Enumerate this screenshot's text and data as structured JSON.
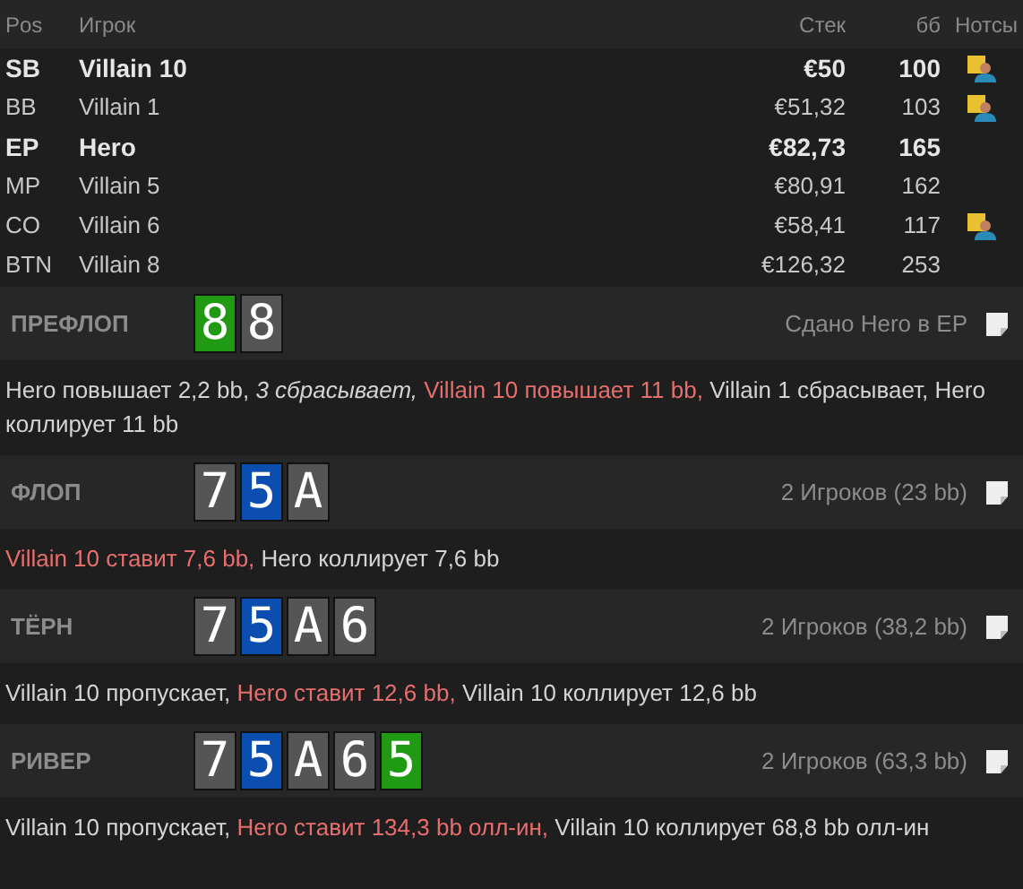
{
  "table": {
    "columns": [
      "Pos",
      "Игрок",
      "Стек",
      "бб",
      "Нотсы"
    ],
    "rows": [
      {
        "pos": "SB",
        "player": "Villain 10",
        "stack": "€50",
        "bb": "100",
        "highlighted": true,
        "has_note": true
      },
      {
        "pos": "BB",
        "player": "Villain 1",
        "stack": "€51,32",
        "bb": "103",
        "highlighted": false,
        "has_note": true
      },
      {
        "pos": "EP",
        "player": "Hero",
        "stack": "€82,73",
        "bb": "165",
        "highlighted": true,
        "has_note": false
      },
      {
        "pos": "MP",
        "player": "Villain 5",
        "stack": "€80,91",
        "bb": "162",
        "highlighted": false,
        "has_note": false
      },
      {
        "pos": "CO",
        "player": "Villain 6",
        "stack": "€58,41",
        "bb": "117",
        "highlighted": false,
        "has_note": true
      },
      {
        "pos": "BTN",
        "player": "Villain 8",
        "stack": "€126,32",
        "bb": "253",
        "highlighted": false,
        "has_note": false
      }
    ]
  },
  "streets": [
    {
      "name": "ПРЕФЛОП",
      "cards": [
        {
          "rank": "8",
          "color": "#1f9a12"
        },
        {
          "rank": "8",
          "color": "#555555"
        }
      ],
      "summary": "Сдано Hero в EP",
      "actions": [
        {
          "kind": "normal",
          "text": "Hero повышает 2,2 bb, "
        },
        {
          "kind": "italic",
          "text": "3 сбрасывает, "
        },
        {
          "kind": "aggressive",
          "text": "Villain 10 повышает 11 bb, "
        },
        {
          "kind": "normal",
          "text": "Villain 1 сбрасывает, Hero коллирует 11 bb"
        }
      ]
    },
    {
      "name": "ФЛОП",
      "cards": [
        {
          "rank": "7",
          "color": "#555555"
        },
        {
          "rank": "5",
          "color": "#0a4fb0"
        },
        {
          "rank": "A",
          "color": "#555555"
        }
      ],
      "summary": "2 Игроков (23 bb)",
      "actions": [
        {
          "kind": "aggressive",
          "text": "Villain 10 ставит 7,6 bb, "
        },
        {
          "kind": "normal",
          "text": "Hero коллирует 7,6 bb"
        }
      ]
    },
    {
      "name": "ТЁРН",
      "cards": [
        {
          "rank": "7",
          "color": "#555555"
        },
        {
          "rank": "5",
          "color": "#0a4fb0"
        },
        {
          "rank": "A",
          "color": "#555555"
        },
        {
          "rank": "6",
          "color": "#555555"
        }
      ],
      "summary": "2 Игроков (38,2 bb)",
      "actions": [
        {
          "kind": "normal",
          "text": "Villain 10 пропускает, "
        },
        {
          "kind": "aggressive",
          "text": "Hero ставит 12,6 bb, "
        },
        {
          "kind": "normal",
          "text": "Villain 10 коллирует 12,6 bb"
        }
      ]
    },
    {
      "name": "РИВЕР",
      "cards": [
        {
          "rank": "7",
          "color": "#555555"
        },
        {
          "rank": "5",
          "color": "#0a4fb0"
        },
        {
          "rank": "A",
          "color": "#555555"
        },
        {
          "rank": "6",
          "color": "#555555"
        },
        {
          "rank": "5",
          "color": "#1f9a12"
        }
      ],
      "summary": "2 Игроков (63,3 bb)",
      "actions": [
        {
          "kind": "normal",
          "text": "Villain 10 пропускает, "
        },
        {
          "kind": "aggressive",
          "text": "Hero ставит 134,3 bb олл-ин, "
        },
        {
          "kind": "normal",
          "text": "Villain 10 коллирует 68,8 bb олл-ин"
        }
      ]
    }
  ]
}
